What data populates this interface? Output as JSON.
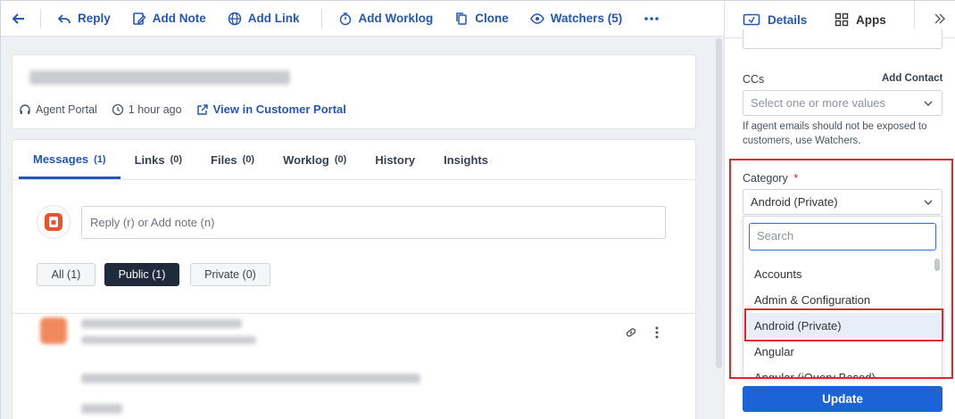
{
  "toolbar": {
    "reply": "Reply",
    "add_note": "Add Note",
    "add_link": "Add Link",
    "add_worklog": "Add Worklog",
    "clone": "Clone",
    "watchers": "Watchers (5)"
  },
  "ticket": {
    "source": "Agent Portal",
    "time": "1 hour ago",
    "portal_link": "View in Customer Portal"
  },
  "tabs": [
    {
      "label": "Messages",
      "count": "(1)"
    },
    {
      "label": "Links",
      "count": "(0)"
    },
    {
      "label": "Files",
      "count": "(0)"
    },
    {
      "label": "Worklog",
      "count": "(0)"
    },
    {
      "label": "History",
      "count": ""
    },
    {
      "label": "Insights",
      "count": ""
    }
  ],
  "reply_box": {
    "placeholder": "Reply (r) or Add note (n)"
  },
  "filters": {
    "all": "All (1)",
    "public": "Public (1)",
    "private": "Private (0)"
  },
  "right_tabs": {
    "details": "Details",
    "apps": "Apps"
  },
  "ccs": {
    "label": "CCs",
    "add_contact": "Add Contact",
    "placeholder": "Select one or more values",
    "helper": "If agent emails should not be exposed to customers, use Watchers."
  },
  "category": {
    "label": "Category",
    "required_mark": "*",
    "value": "Android (Private)",
    "search_placeholder": "Search",
    "options": [
      "Accounts",
      "Admin & Configuration",
      "Android (Private)",
      "Angular",
      "Angular (jQuery Based)"
    ],
    "selected_index": 2
  },
  "update_label": "Update",
  "colors": {
    "accent": "#2356b8",
    "highlight": "#e0262b",
    "button": "#1c63d8"
  }
}
